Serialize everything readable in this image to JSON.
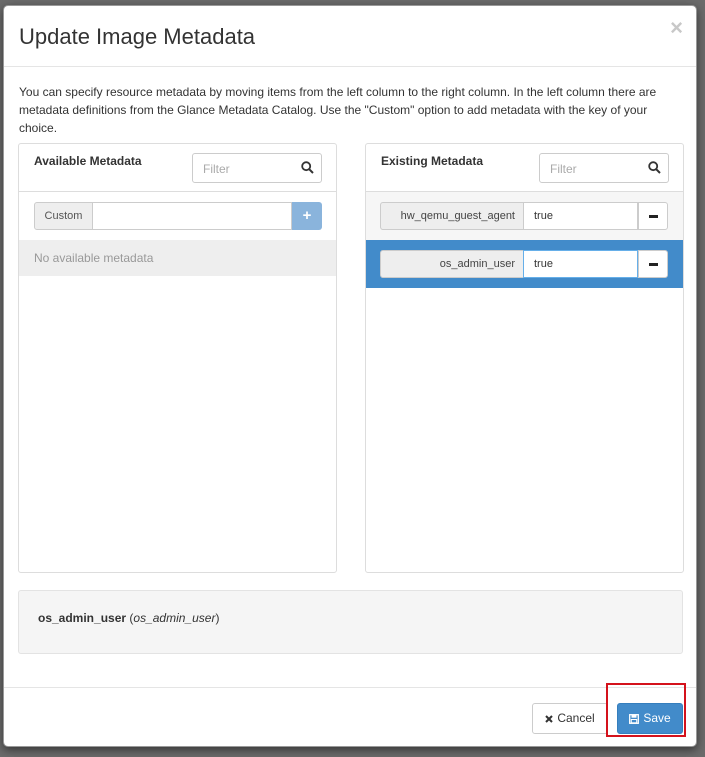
{
  "modal": {
    "title": "Update Image Metadata",
    "close_glyph": "×",
    "intro": "You can specify resource metadata by moving items from the left column to the right column. In the left column there are metadata definitions from the Glance Metadata Catalog. Use the \"Custom\" option to add metadata with the key of your choice."
  },
  "available": {
    "title": "Available Metadata",
    "filter_placeholder": "Filter",
    "custom_label": "Custom",
    "custom_value": "",
    "add_glyph": "+",
    "empty_text": "No available metadata"
  },
  "existing": {
    "title": "Existing Metadata",
    "filter_placeholder": "Filter",
    "items": [
      {
        "key": "hw_qemu_guest_agent",
        "value": "true"
      },
      {
        "key": "os_admin_user",
        "value": "true"
      }
    ]
  },
  "description": {
    "name": "os_admin_user",
    "key": "os_admin_user"
  },
  "footer": {
    "cancel_label": "Cancel",
    "save_label": "Save"
  },
  "icons": {
    "search": "search-icon",
    "close": "close-icon",
    "cancel": "times-icon",
    "save": "floppy-disk-icon"
  },
  "colors": {
    "primary": "#428bca",
    "selected_row": "#428bca",
    "highlight": "#d4121c"
  }
}
